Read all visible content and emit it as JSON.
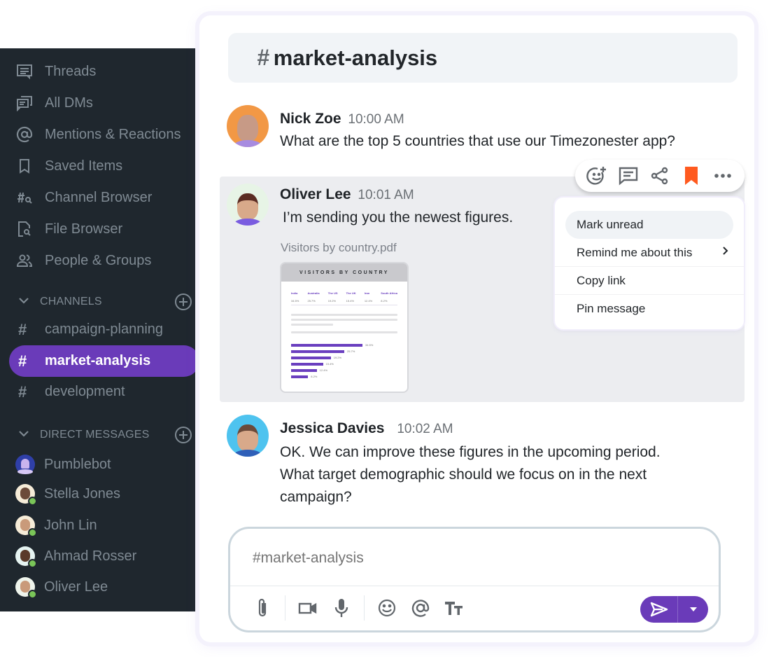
{
  "sidebar": {
    "nav": [
      {
        "label": "Threads",
        "icon": "threads-icon"
      },
      {
        "label": "All DMs",
        "icon": "all-dms-icon"
      },
      {
        "label": "Mentions & Reactions",
        "icon": "at-sign-icon"
      },
      {
        "label": "Saved Items",
        "icon": "bookmark-icon"
      },
      {
        "label": "Channel Browser",
        "icon": "channel-search-icon"
      },
      {
        "label": "File Browser",
        "icon": "file-search-icon"
      },
      {
        "label": "People & Groups",
        "icon": "people-icon"
      }
    ],
    "channels_header": "CHANNELS",
    "channels": [
      {
        "hash": "#",
        "label": "campaign-planning",
        "active": false
      },
      {
        "hash": "#",
        "label": "market-analysis",
        "active": true
      },
      {
        "hash": "#",
        "label": "development",
        "active": false
      }
    ],
    "dms_header": "DIRECT MESSAGES",
    "dms": [
      {
        "label": "Pumblebot",
        "online": false
      },
      {
        "label": "Stella Jones",
        "online": true
      },
      {
        "label": "John Lin",
        "online": true
      },
      {
        "label": "Ahmad Rosser",
        "online": true
      },
      {
        "label": "Oliver Lee",
        "online": true
      }
    ]
  },
  "channel": {
    "hash": "#",
    "name": "market-analysis"
  },
  "messages": [
    {
      "author": "Nick Zoe",
      "time": "10:00 AM",
      "text": "What are the top 5 countries that use our Timezonester app?"
    },
    {
      "author": "Oliver Lee",
      "time": "10:01 AM",
      "text": "I’m sending you the newest figures.",
      "attachment": {
        "filename": "Visitors by country.pdf",
        "title": "VISITORS BY COUNTRY",
        "countries": [
          "India",
          "Australia",
          "The US",
          "The UK",
          "Iran",
          "South Africa"
        ],
        "values": [
          "34.5%",
          "25.7%",
          "19.2%",
          "15.4%",
          "12.4%",
          "8.2%"
        ],
        "bar_values": [
          34.5,
          25.7,
          19.2,
          15.4,
          12.4,
          8.2
        ]
      }
    },
    {
      "author": "Jessica Davies",
      "time": "10:02 AM",
      "lines": [
        "OK. We can improve these figures in the upcoming period.",
        "What target demographic should we focus on in the next",
        "campaign?"
      ]
    }
  ],
  "message_toolbar": {
    "icons": [
      "add-reaction-icon",
      "reply-thread-icon",
      "share-icon",
      "saved-bookmark-icon",
      "more-icon"
    ],
    "bookmark_color": "#ff5a1f"
  },
  "context_menu": {
    "items": [
      {
        "label": "Mark unread",
        "submenu": false
      },
      {
        "label": "Remind me about this",
        "submenu": true
      },
      {
        "label": "Copy link",
        "submenu": false
      },
      {
        "label": "Pin message",
        "submenu": false
      }
    ],
    "chevron": "›"
  },
  "composer": {
    "placeholder": "#market-analysis",
    "tools": [
      "attach-icon",
      "video-icon",
      "microphone-icon",
      "emoji-icon",
      "mention-icon",
      "text-format-icon"
    ]
  },
  "colors": {
    "accent": "#6a3bb9",
    "sidebar_bg": "#1f272e",
    "online": "#7ac558",
    "bookmark": "#ff5a1f"
  }
}
